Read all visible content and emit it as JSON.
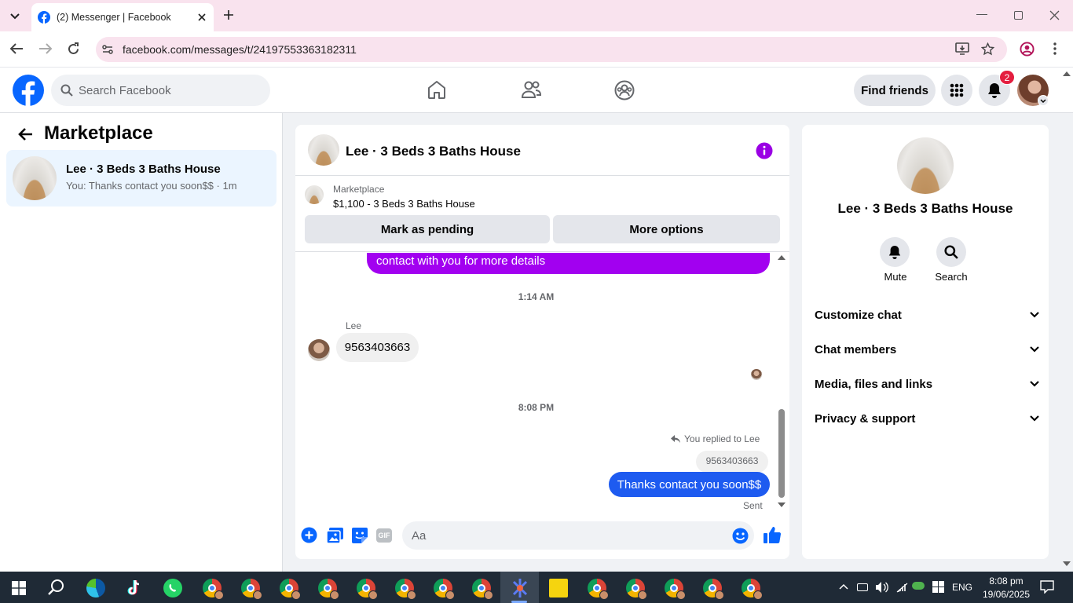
{
  "browser": {
    "tab_title": "(2) Messenger | Facebook",
    "url": "facebook.com/messages/t/24197553363182311"
  },
  "fb": {
    "search_placeholder": "Search Facebook",
    "find_friends": "Find friends",
    "notification_count": "2"
  },
  "left": {
    "title": "Marketplace",
    "conversation": {
      "name": "Lee · 3 Beds 3 Baths House",
      "preview": "You: Thanks contact you soon$$ · 1m"
    }
  },
  "chat": {
    "title": "Lee · 3 Beds 3 Baths House",
    "marketplace_label": "Marketplace",
    "listing": "$1,100 - 3 Beds 3 Baths House",
    "mark_pending": "Mark as pending",
    "more_options": "More options",
    "messages": {
      "partial_sent": "contact with you for more details",
      "time1": "1:14 AM",
      "sender": "Lee",
      "received": "9563403663",
      "time2": "8:08 PM",
      "reply_note": "You replied to Lee",
      "quoted": "9563403663",
      "sent": "Thanks contact you soon$$",
      "status": "Sent"
    },
    "composer_placeholder": "Aa"
  },
  "right": {
    "name": "Lee · 3 Beds 3 Baths House",
    "mute": "Mute",
    "search": "Search",
    "sections": [
      "Customize chat",
      "Chat members",
      "Media, files and links",
      "Privacy & support"
    ]
  },
  "taskbar": {
    "lang": "ENG",
    "time": "8:08 pm",
    "date": "19/06/2025"
  },
  "colors": {
    "fb_blue": "#0866ff",
    "messenger_purple": "#a200f0",
    "sent_blue": "#1e5bf0",
    "info_purple": "#9a00e4"
  }
}
